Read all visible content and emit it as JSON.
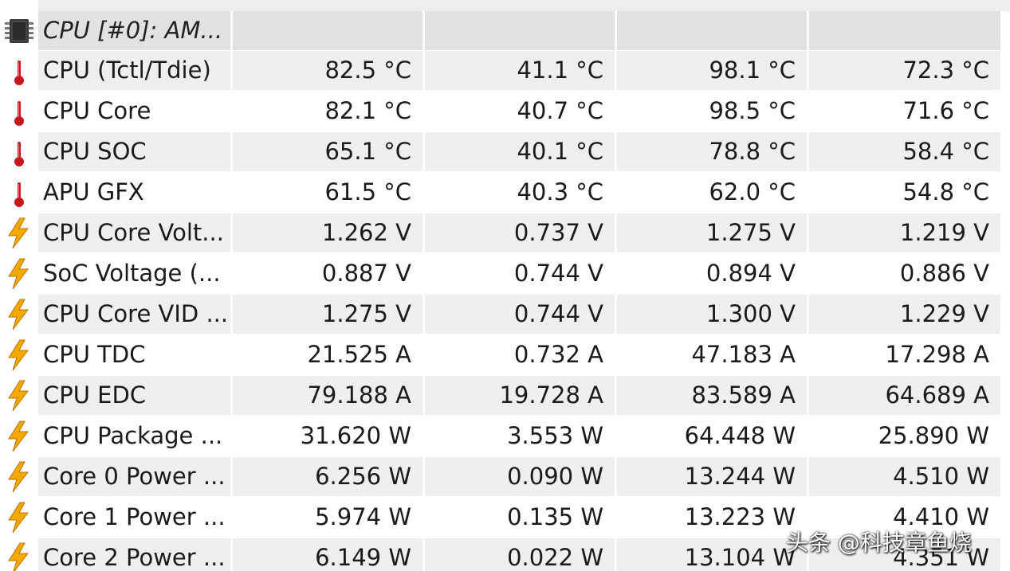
{
  "group": {
    "label": "CPU [#0]: AM...",
    "icon": "chip-icon"
  },
  "rows": [
    {
      "label": "CPU (Tctl/Tdie)",
      "icon": "thermometer-icon",
      "values": [
        "82.5 °C",
        "41.1 °C",
        "98.1 °C",
        "72.3 °C"
      ]
    },
    {
      "label": "CPU Core",
      "icon": "thermometer-icon",
      "values": [
        "82.1 °C",
        "40.7 °C",
        "98.5 °C",
        "71.6 °C"
      ]
    },
    {
      "label": "CPU SOC",
      "icon": "thermometer-icon",
      "values": [
        "65.1 °C",
        "40.1 °C",
        "78.8 °C",
        "58.4 °C"
      ]
    },
    {
      "label": "APU GFX",
      "icon": "thermometer-icon",
      "values": [
        "61.5 °C",
        "40.3 °C",
        "62.0 °C",
        "54.8 °C"
      ]
    },
    {
      "label": "CPU Core Volt...",
      "icon": "lightning-icon",
      "values": [
        "1.262 V",
        "0.737 V",
        "1.275 V",
        "1.219 V"
      ]
    },
    {
      "label": "SoC Voltage (...",
      "icon": "lightning-icon",
      "values": [
        "0.887 V",
        "0.744 V",
        "0.894 V",
        "0.886 V"
      ]
    },
    {
      "label": "CPU Core VID ...",
      "icon": "lightning-icon",
      "values": [
        "1.275 V",
        "0.744 V",
        "1.300 V",
        "1.229 V"
      ]
    },
    {
      "label": "CPU TDC",
      "icon": "lightning-icon",
      "values": [
        "21.525 A",
        "0.732 A",
        "47.183 A",
        "17.298 A"
      ]
    },
    {
      "label": "CPU EDC",
      "icon": "lightning-icon",
      "values": [
        "79.188 A",
        "19.728 A",
        "83.589 A",
        "64.689 A"
      ]
    },
    {
      "label": "CPU Package ...",
      "icon": "lightning-icon",
      "values": [
        "31.620 W",
        "3.553 W",
        "64.448 W",
        "25.890 W"
      ]
    },
    {
      "label": "Core 0 Power ...",
      "icon": "lightning-icon",
      "values": [
        "6.256 W",
        "0.090 W",
        "13.244 W",
        "4.510 W"
      ]
    },
    {
      "label": "Core 1 Power ...",
      "icon": "lightning-icon",
      "values": [
        "5.974 W",
        "0.135 W",
        "13.223 W",
        "4.410 W"
      ]
    },
    {
      "label": "Core 2 Power ...",
      "icon": "lightning-icon",
      "values": [
        "6.149 W",
        "0.022 W",
        "13.104 W",
        "4.351 W"
      ]
    }
  ],
  "watermark": "头条 @科技章鱼烧",
  "colors": {
    "thermometer": "#c8161d",
    "lightning": "#f5a800",
    "chip": "#3a3a3a"
  }
}
